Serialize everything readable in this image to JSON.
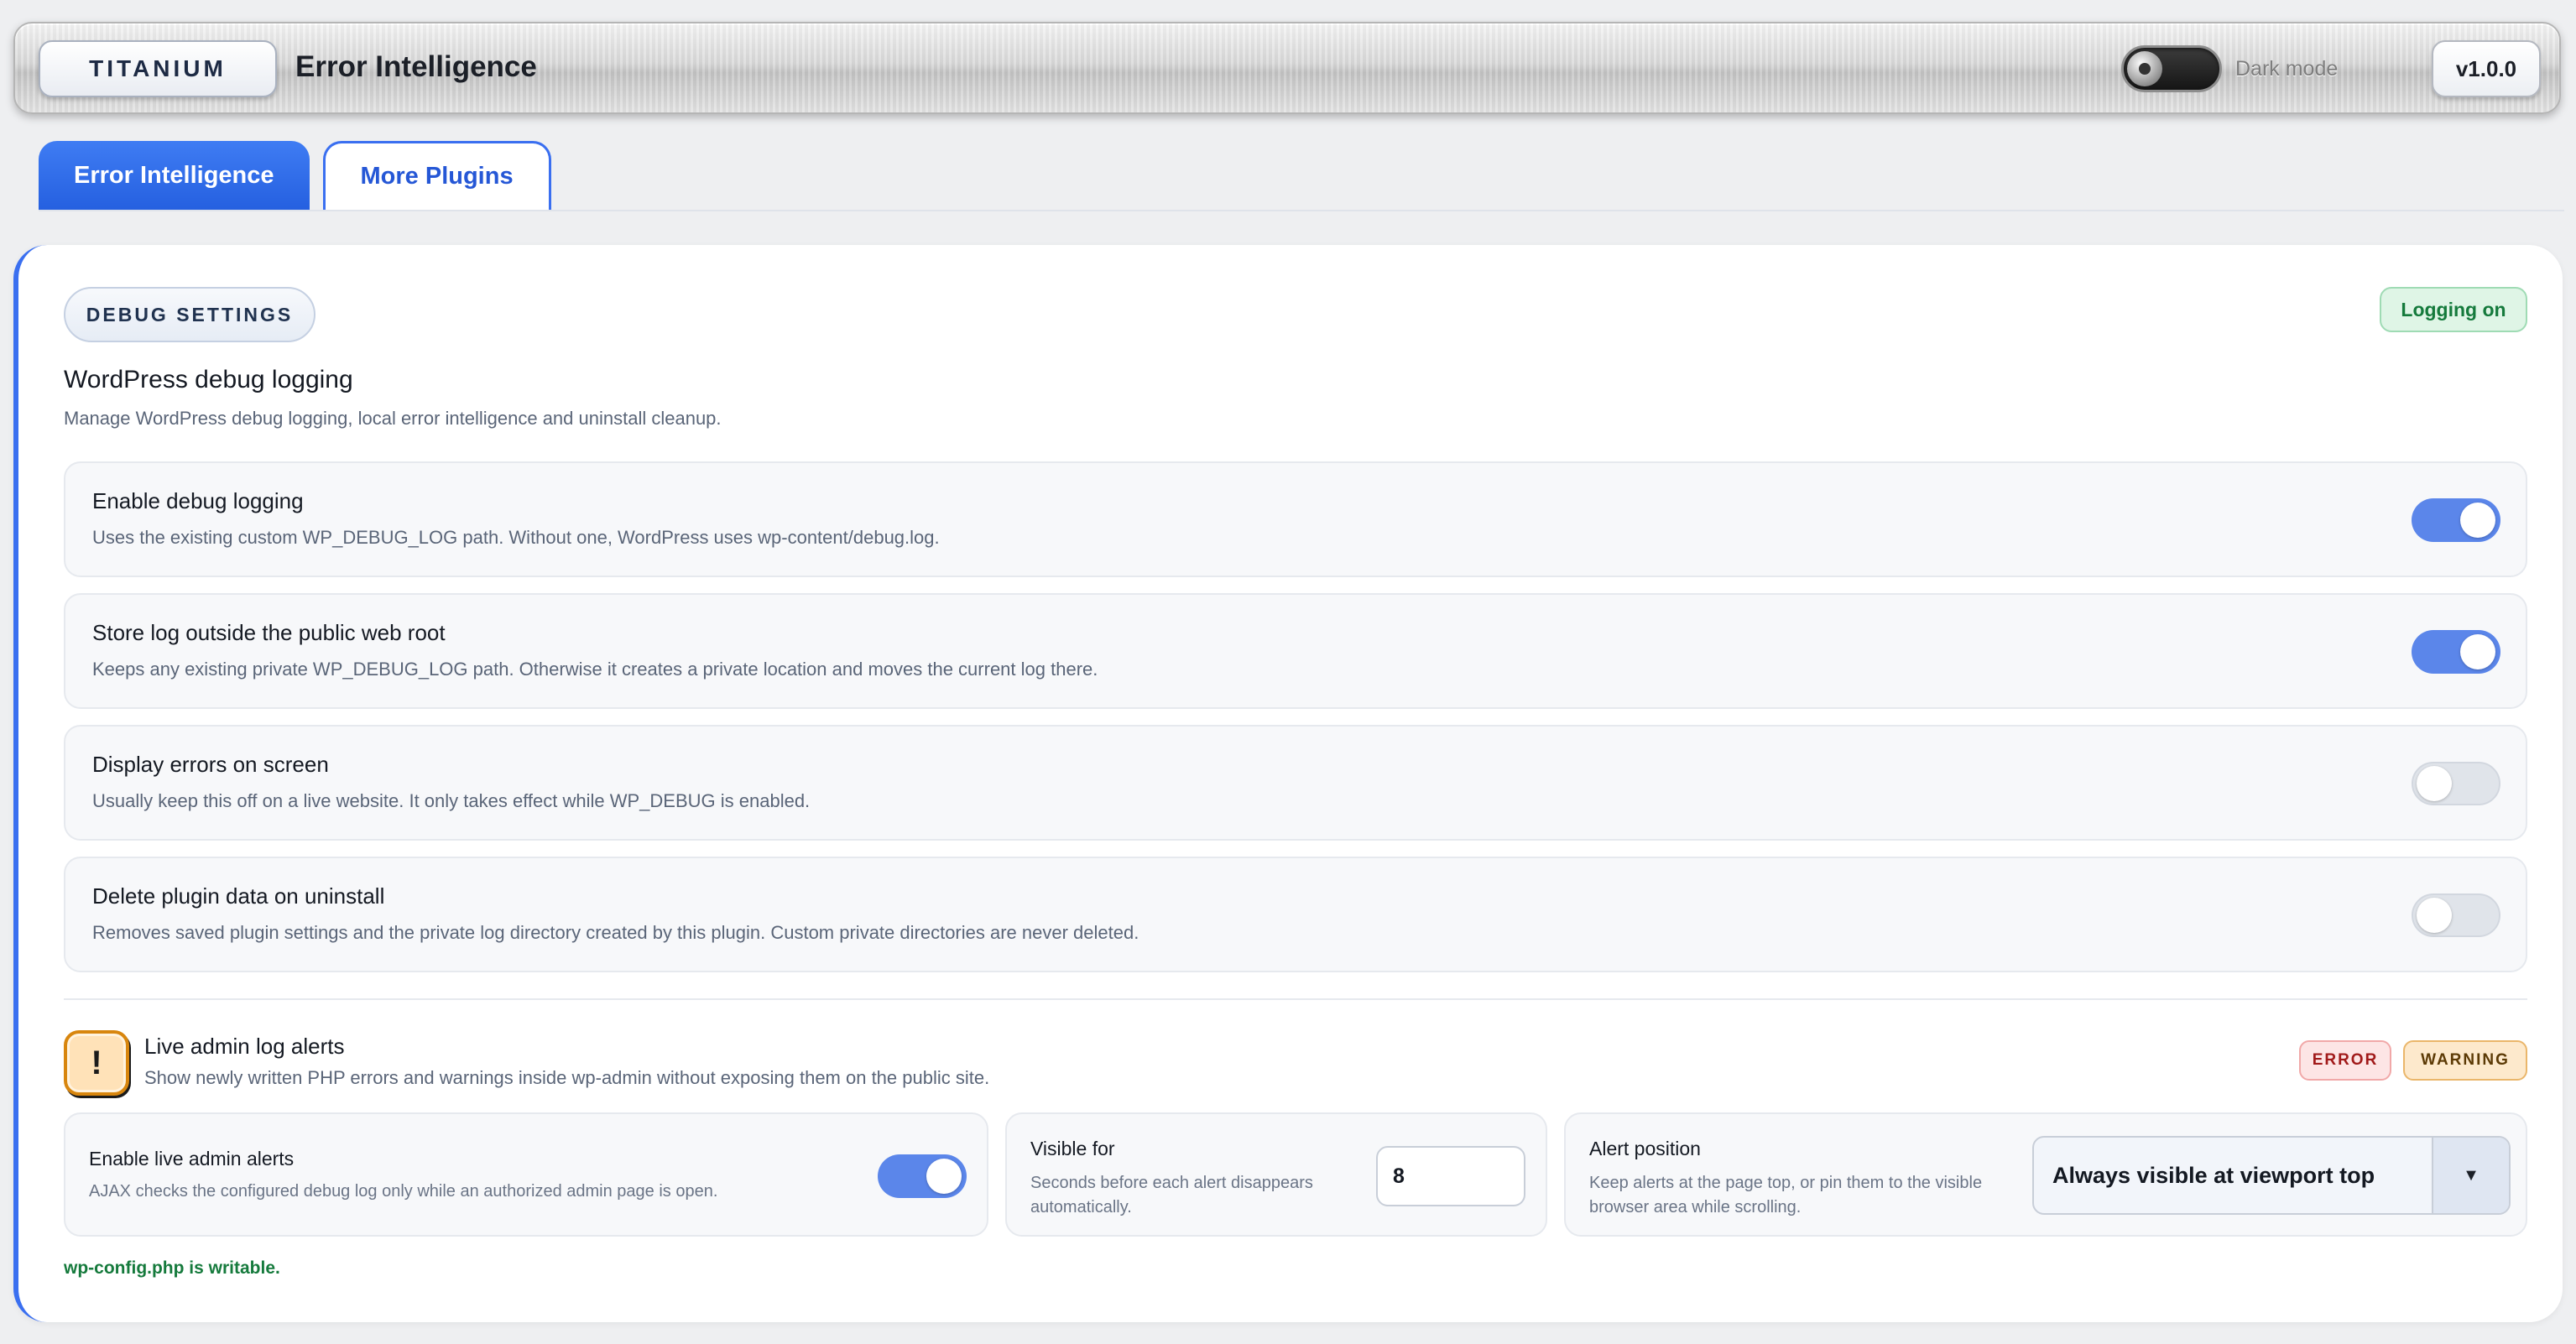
{
  "header": {
    "brand": "TITANIUM",
    "title": "Error Intelligence",
    "dark_mode_label": "Dark mode",
    "dark_mode_on": false,
    "version": "v1.0.0"
  },
  "tabs": [
    {
      "label": "Error Intelligence",
      "active": true
    },
    {
      "label": "More Plugins",
      "active": false
    }
  ],
  "panel": {
    "section_pill": "DEBUG SETTINGS",
    "status_badge": "Logging on",
    "title": "WordPress debug logging",
    "description": "Manage WordPress debug logging, local error intelligence and uninstall cleanup.",
    "settings": [
      {
        "title": "Enable debug logging",
        "desc": "Uses the existing custom WP_DEBUG_LOG path. Without one, WordPress uses wp-content/debug.log.",
        "enabled": true
      },
      {
        "title": "Store log outside the public web root",
        "desc": "Keeps any existing private WP_DEBUG_LOG path. Otherwise it creates a private location and moves the current log there.",
        "enabled": true
      },
      {
        "title": "Display errors on screen",
        "desc": "Usually keep this off on a live website. It only takes effect while WP_DEBUG is enabled.",
        "enabled": false
      },
      {
        "title": "Delete plugin data on uninstall",
        "desc": "Removes saved plugin settings and the private log directory created by this plugin. Custom private directories are never deleted.",
        "enabled": false
      }
    ],
    "alerts": {
      "icon": "exclamation-icon",
      "icon_glyph": "!",
      "title": "Live admin log alerts",
      "description": "Show newly written PHP errors and warnings inside wp-admin without exposing them on the public site.",
      "chips": [
        "ERROR",
        "WARNING"
      ],
      "enable": {
        "title": "Enable live admin alerts",
        "desc": "AJAX checks the configured debug log only while an authorized admin page is open.",
        "enabled": true
      },
      "visible_for": {
        "title": "Visible for",
        "desc_line1": "Seconds before each alert disappears",
        "desc_line2": "automatically.",
        "value": "8"
      },
      "position": {
        "title": "Alert position",
        "desc_line1": "Keep alerts at the page top, or pin them to the visible",
        "desc_line2": "browser area while scrolling.",
        "selected": "Always visible at viewport top",
        "arrow": "▼"
      }
    },
    "config_status": "wp-config.php is writable."
  },
  "colors": {
    "accent": "#2f6ae8",
    "success": "#157a3c",
    "error": "#a11a1a",
    "warning": "#d8860e"
  }
}
